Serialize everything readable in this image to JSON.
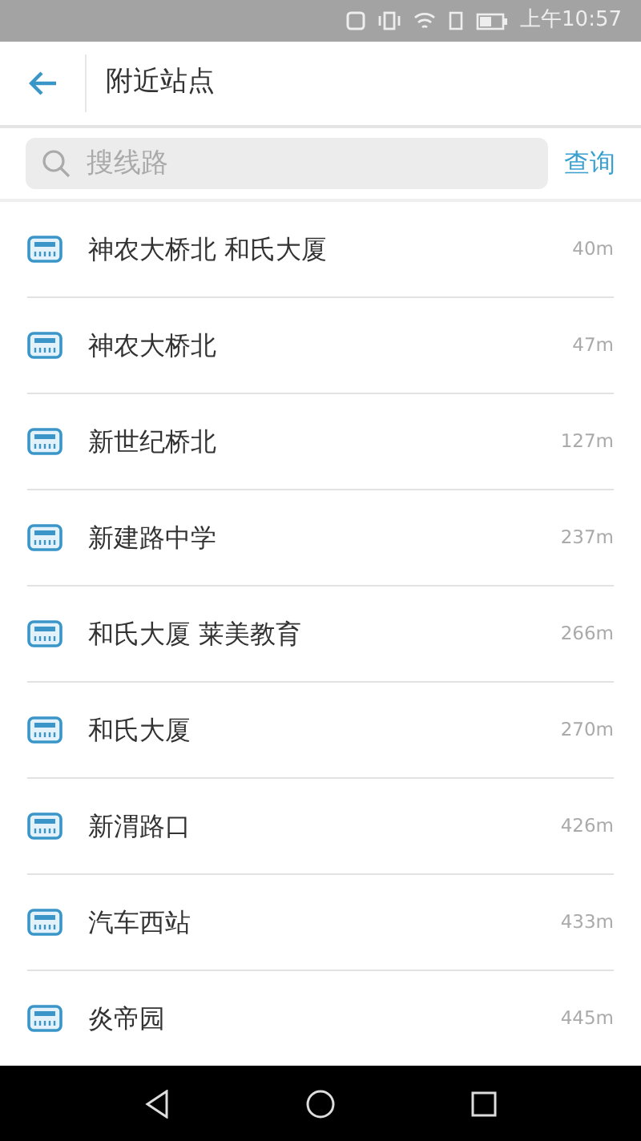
{
  "status_bar": {
    "time": "上午10:57"
  },
  "header": {
    "title": "附近站点"
  },
  "search": {
    "placeholder": "搜线路",
    "button": "查询"
  },
  "stations": [
    {
      "name": "神农大桥北 和氏大厦",
      "distance": "40m"
    },
    {
      "name": "神农大桥北",
      "distance": "47m"
    },
    {
      "name": "新世纪桥北",
      "distance": "127m"
    },
    {
      "name": "新建路中学",
      "distance": "237m"
    },
    {
      "name": "和氏大厦 莱美教育",
      "distance": "266m"
    },
    {
      "name": "和氏大厦",
      "distance": "270m"
    },
    {
      "name": "新渭路口",
      "distance": "426m"
    },
    {
      "name": "汽车西站",
      "distance": "433m"
    },
    {
      "name": "炎帝园",
      "distance": "445m"
    }
  ]
}
